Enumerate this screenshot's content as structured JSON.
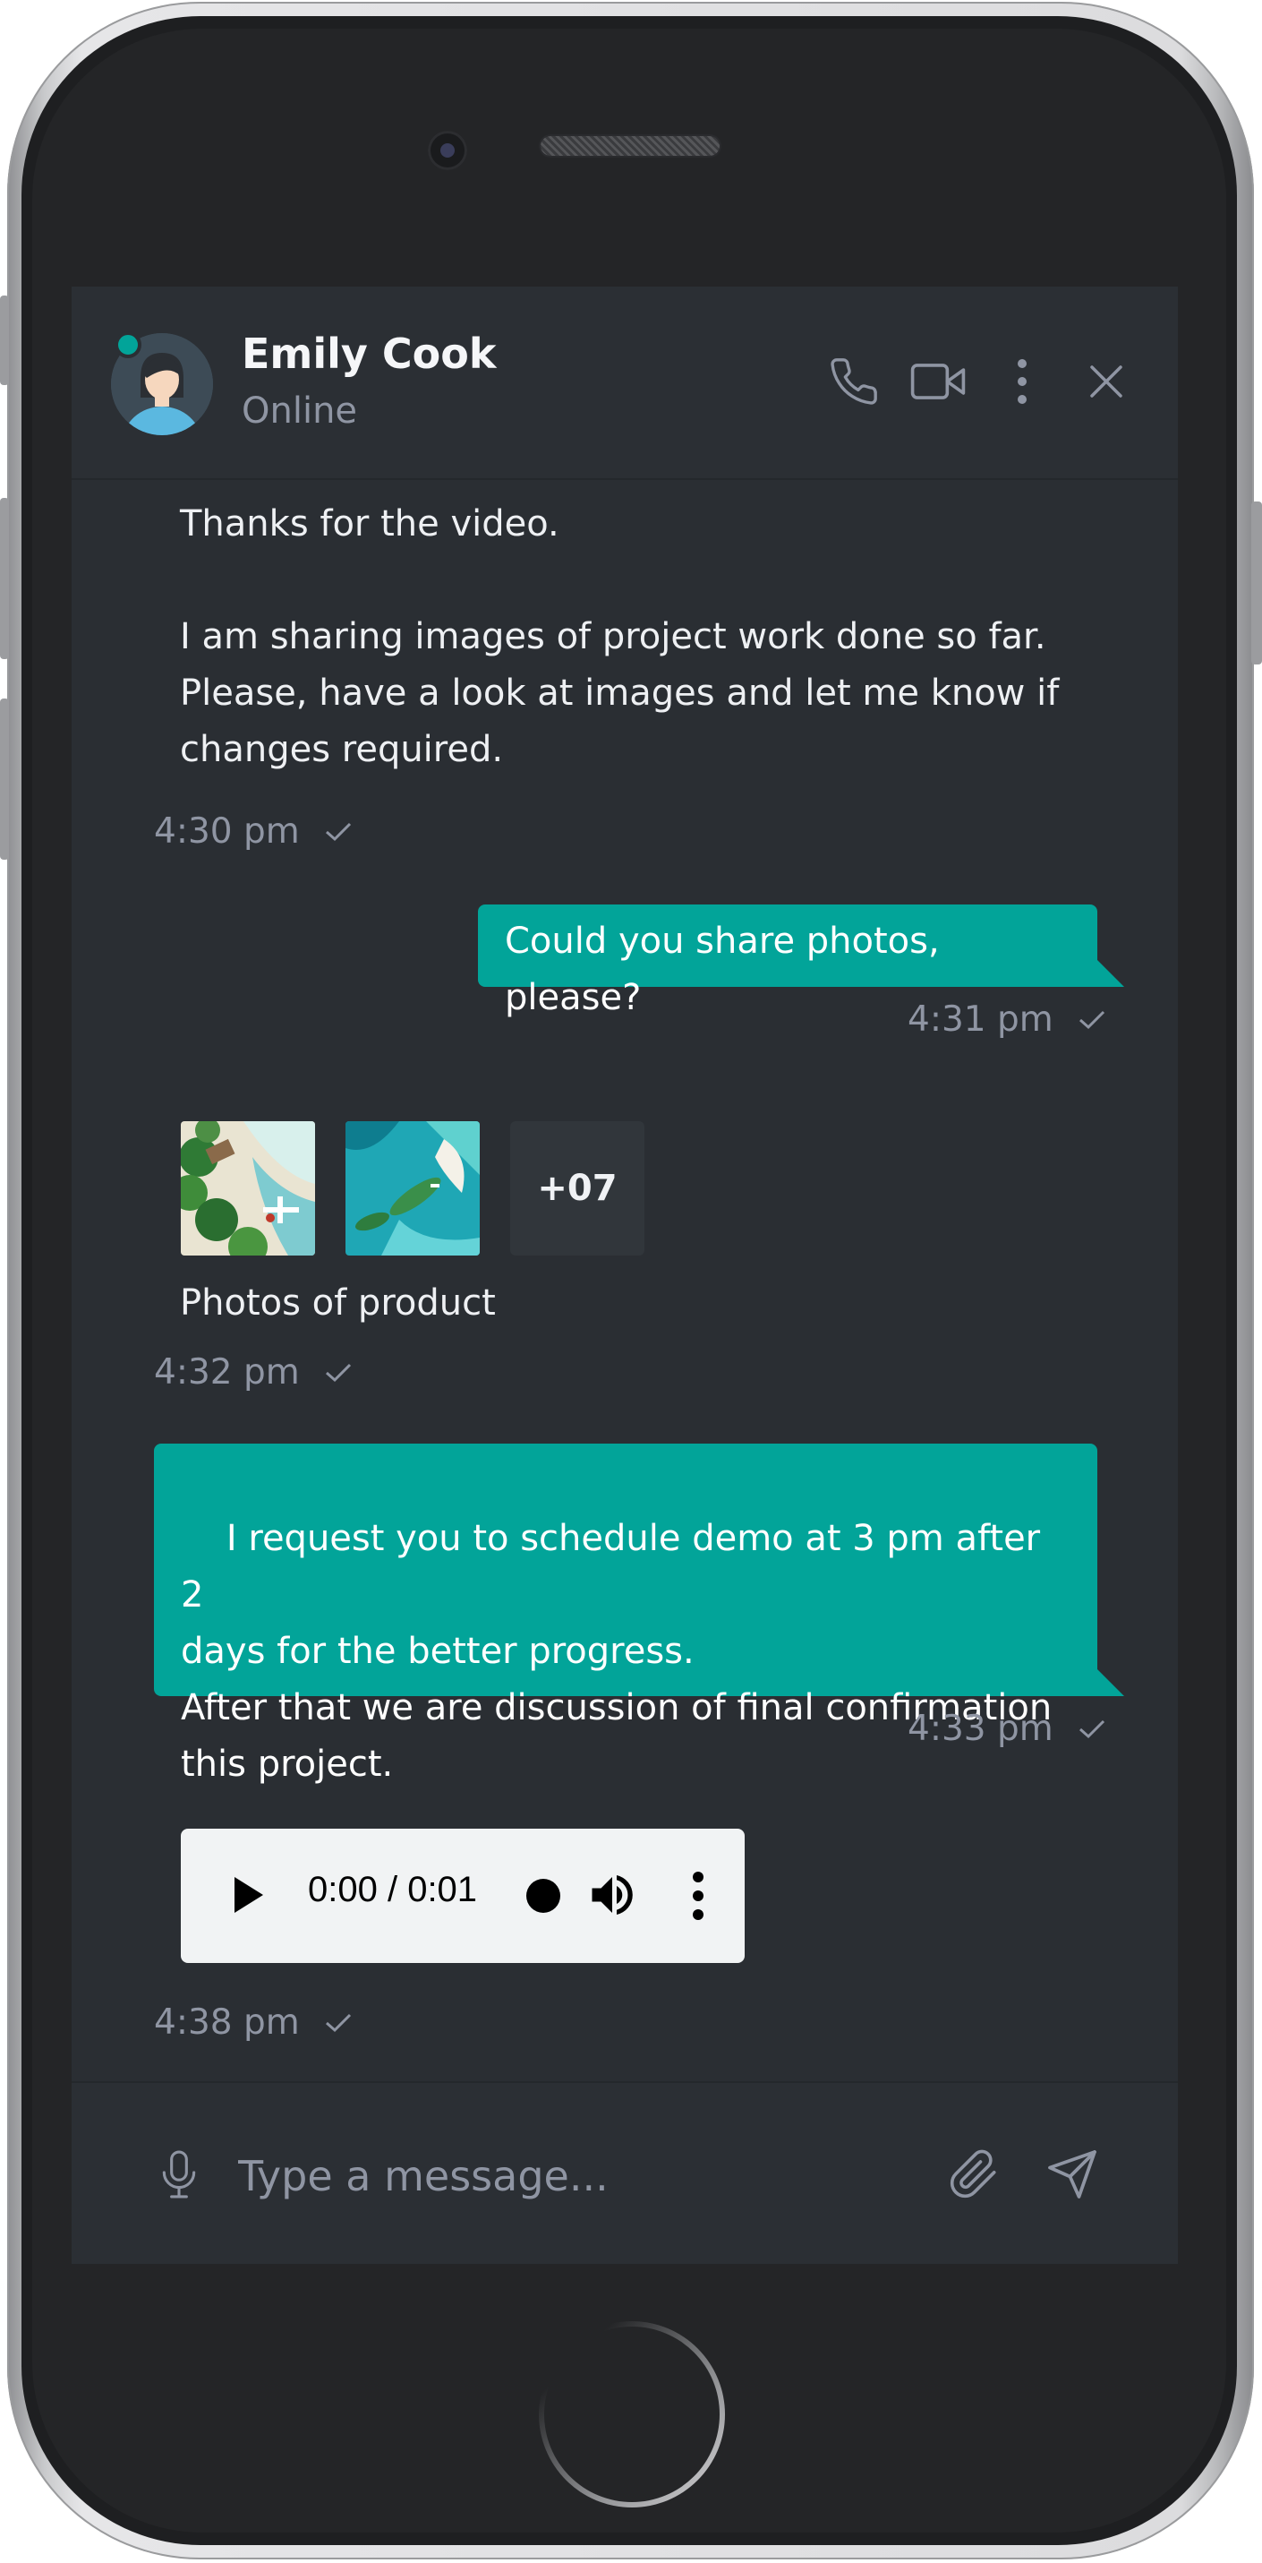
{
  "contact": {
    "name": "Emily Cook",
    "status": "Online"
  },
  "header_actions": [
    "phone-icon",
    "video-camera-icon",
    "more-vertical-icon",
    "close-icon"
  ],
  "messages": [
    {
      "direction": "incoming",
      "text": "Thanks for the video.\n\nI am sharing images of project work done so far.\nPlease, have a look at images and let me know if\nchanges required.",
      "time": "4:30 pm"
    },
    {
      "direction": "outgoing",
      "text": "Could you share photos, please?",
      "time": "4:31 pm"
    },
    {
      "direction": "incoming",
      "type": "images",
      "more_count": "+07",
      "caption": "Photos of product",
      "time": "4:32 pm"
    },
    {
      "direction": "outgoing",
      "text": "I request you to schedule demo at 3 pm after 2\ndays for the better progress.\nAfter that we are discussion of final confirmation\nthis project.",
      "time": "4:33 pm"
    },
    {
      "direction": "incoming",
      "type": "audio",
      "audio_time": "0:00 / 0:01",
      "progress": 0,
      "time": "4:38 pm"
    }
  ],
  "composer": {
    "placeholder": "Type a message..."
  },
  "colors": {
    "accent": "#02a499",
    "background": "#2a2e33",
    "muted_text": "#8f95a3"
  }
}
